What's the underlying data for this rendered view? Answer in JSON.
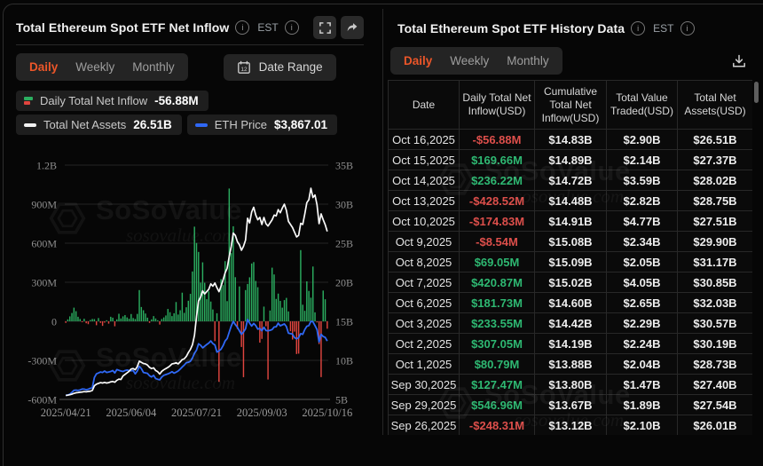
{
  "colors": {
    "accent_orange": "#eb5629",
    "green": "#2eb872",
    "red": "#dd4f4b",
    "bar_green": "#2bae60",
    "bar_red": "#e0453f",
    "line_white": "#fafafa",
    "line_blue": "#2f68f5"
  },
  "brand": {
    "watermark_title": "SoSoValue",
    "watermark_domain": "sosovalue.com"
  },
  "left_panel": {
    "title": "Total Ethereum Spot ETF Net Inflow",
    "timezone_label": "EST",
    "tabs": [
      {
        "label": "Daily",
        "active": true
      },
      {
        "label": "Weekly",
        "active": false
      },
      {
        "label": "Monthly",
        "active": false
      }
    ],
    "date_range_button": {
      "label": "Date Range",
      "calendar_day": "12"
    },
    "legend": {
      "inflow": {
        "label": "Daily Total Net Inflow",
        "value": "-56.88M"
      },
      "assets": {
        "label": "Total Net Assets",
        "value": "26.51B"
      },
      "eth_price": {
        "label": "ETH Price",
        "value": "$3,867.01"
      }
    }
  },
  "right_panel": {
    "title": "Total Ethereum Spot ETF History Data",
    "timezone_label": "EST",
    "tabs": [
      {
        "label": "Daily",
        "active": true
      },
      {
        "label": "Weekly",
        "active": false
      },
      {
        "label": "Monthly",
        "active": false
      }
    ],
    "table": {
      "columns": [
        "Date",
        "Daily Total Net Inflow(USD)",
        "Cumulative Total Net Inflow(USD)",
        "Total Value Traded(USD)",
        "Total Net Assets(USD)"
      ],
      "rows": [
        {
          "date": "Oct 16,2025",
          "daily_inflow": "-$56.88M",
          "cumulative_inflow": "$14.83B",
          "value_traded": "$2.90B",
          "net_assets": "$26.51B"
        },
        {
          "date": "Oct 15,2025",
          "daily_inflow": "$169.66M",
          "cumulative_inflow": "$14.89B",
          "value_traded": "$2.14B",
          "net_assets": "$27.37B"
        },
        {
          "date": "Oct 14,2025",
          "daily_inflow": "$236.22M",
          "cumulative_inflow": "$14.72B",
          "value_traded": "$3.59B",
          "net_assets": "$28.02B"
        },
        {
          "date": "Oct 13,2025",
          "daily_inflow": "-$428.52M",
          "cumulative_inflow": "$14.48B",
          "value_traded": "$2.82B",
          "net_assets": "$28.75B"
        },
        {
          "date": "Oct 10,2025",
          "daily_inflow": "-$174.83M",
          "cumulative_inflow": "$14.91B",
          "value_traded": "$4.77B",
          "net_assets": "$27.51B"
        },
        {
          "date": "Oct 9,2025",
          "daily_inflow": "-$8.54M",
          "cumulative_inflow": "$15.08B",
          "value_traded": "$2.34B",
          "net_assets": "$29.90B"
        },
        {
          "date": "Oct 8,2025",
          "daily_inflow": "$69.05M",
          "cumulative_inflow": "$15.09B",
          "value_traded": "$2.05B",
          "net_assets": "$31.17B"
        },
        {
          "date": "Oct 7,2025",
          "daily_inflow": "$420.87M",
          "cumulative_inflow": "$15.02B",
          "value_traded": "$4.05B",
          "net_assets": "$30.85B"
        },
        {
          "date": "Oct 6,2025",
          "daily_inflow": "$181.73M",
          "cumulative_inflow": "$14.60B",
          "value_traded": "$2.65B",
          "net_assets": "$32.03B"
        },
        {
          "date": "Oct 3,2025",
          "daily_inflow": "$233.55M",
          "cumulative_inflow": "$14.42B",
          "value_traded": "$2.29B",
          "net_assets": "$30.57B"
        },
        {
          "date": "Oct 2,2025",
          "daily_inflow": "$307.05M",
          "cumulative_inflow": "$14.19B",
          "value_traded": "$2.24B",
          "net_assets": "$30.19B"
        },
        {
          "date": "Oct 1,2025",
          "daily_inflow": "$80.79M",
          "cumulative_inflow": "$13.88B",
          "value_traded": "$2.04B",
          "net_assets": "$28.73B"
        },
        {
          "date": "Sep 30,2025",
          "daily_inflow": "$127.47M",
          "cumulative_inflow": "$13.80B",
          "value_traded": "$1.47B",
          "net_assets": "$27.40B"
        },
        {
          "date": "Sep 29,2025",
          "daily_inflow": "$546.96M",
          "cumulative_inflow": "$13.67B",
          "value_traded": "$1.89B",
          "net_assets": "$27.54B"
        },
        {
          "date": "Sep 26,2025",
          "daily_inflow": "-$248.31M",
          "cumulative_inflow": "$13.12B",
          "value_traded": "$2.10B",
          "net_assets": "$26.01B"
        }
      ]
    }
  },
  "chart_data": {
    "type": "composite",
    "x_tick_labels": [
      "2025/04/21",
      "2025/06/04",
      "2025/07/21",
      "2025/09/03",
      "2025/10/16"
    ],
    "left_axis": {
      "title": "Daily Net Inflow (USD)",
      "ticks": [
        "1.2B",
        "900M",
        "600M",
        "300M",
        "0",
        "-300M",
        "-600M"
      ],
      "max_m": 1200,
      "min_m": -600
    },
    "right_axis": {
      "title": "Total Net Assets (USD)",
      "ticks": [
        "35B",
        "30B",
        "25B",
        "20B",
        "15B",
        "10B",
        "5B"
      ],
      "max_b": 35,
      "min_b": 5
    },
    "eth_axis": {
      "hidden": true,
      "min_usd": 1400,
      "max_usd": 5000
    },
    "grid": true,
    "legend_position": "top-left",
    "series": [
      {
        "name": "Daily Total Net Inflow",
        "type": "bar",
        "unit": "M USD",
        "values": [
          -12,
          15,
          38,
          64,
          105,
          78,
          35,
          18,
          -6,
          20,
          -15,
          -22,
          10,
          18,
          17,
          -30,
          25,
          -12,
          -35,
          -10,
          8,
          -18,
          35,
          28,
          -38,
          15,
          58,
          22,
          38,
          48,
          30,
          20,
          56,
          25,
          18,
          57,
          240,
          110,
          85,
          60,
          28,
          -12,
          15,
          40,
          22,
          8,
          -25,
          18,
          30,
          45,
          95,
          70,
          40,
          62,
          148,
          52,
          85,
          220,
          65,
          108,
          158,
          211,
          383,
          727,
          602,
          533,
          297,
          453,
          296,
          170,
          230,
          152,
          91,
          -152,
          62,
          -465,
          324,
          278,
          462,
          155,
          1020,
          524,
          730,
          339,
          -59,
          268,
          -197,
          -429,
          240,
          287,
          338,
          444,
          455,
          310,
          262,
          -164,
          -135,
          113,
          -38,
          -447,
          83,
          412,
          360,
          172,
          213,
          157,
          105,
          163,
          180,
          76,
          -76,
          -140,
          -79,
          -251,
          -248.31,
          546.96,
          127.47,
          80.79,
          307.05,
          233.55,
          181.73,
          420.87,
          69.05,
          -8.54,
          -174.83,
          -428.52,
          236.22,
          169.66,
          -56.88
        ]
      },
      {
        "name": "Total Net Assets",
        "type": "line",
        "unit": "B USD",
        "values": [
          5.5,
          5.55,
          5.6,
          5.68,
          5.78,
          5.85,
          5.88,
          5.92,
          5.95,
          6.0,
          5.98,
          6.02,
          6.05,
          6.15,
          6.75,
          6.95,
          7.05,
          7.15,
          7.1,
          7.18,
          7.1,
          7.15,
          7.25,
          7.3,
          7.2,
          7.45,
          7.6,
          7.55,
          8.0,
          8.2,
          8.4,
          8.6,
          8.9,
          8.95,
          8.8,
          9.2,
          9.9,
          9.75,
          9.6,
          9.55,
          9.4,
          9.1,
          8.95,
          9.05,
          8.7,
          8.55,
          8.25,
          8.6,
          8.8,
          8.95,
          9.1,
          9.3,
          9.55,
          9.6,
          9.7,
          9.55,
          9.8,
          10.1,
          10.2,
          10.5,
          11.0,
          11.4,
          12.0,
          13.2,
          15.6,
          17.6,
          18.1,
          18.9,
          18.5,
          18.8,
          19.1,
          19.8,
          19.5,
          19.9,
          19.3,
          18.8,
          19.5,
          20.3,
          21.2,
          21.8,
          23.3,
          24.6,
          26.3,
          26.0,
          25.2,
          24.8,
          24.1,
          24.6,
          25.4,
          28.2,
          27.6,
          29.0,
          29.6,
          28.6,
          28.0,
          28.3,
          27.4,
          28.3,
          27.5,
          27.2,
          27.6,
          28.0,
          28.6,
          28.5,
          29.3,
          28.9,
          29.5,
          30.0,
          29.2,
          27.8,
          27.4,
          27.0,
          26.4,
          25.8,
          26.01,
          27.54,
          27.4,
          28.73,
          30.19,
          30.57,
          32.03,
          30.85,
          31.17,
          29.9,
          27.51,
          28.75,
          28.02,
          27.37,
          26.51
        ]
      },
      {
        "name": "ETH Price",
        "type": "line",
        "unit": "USD",
        "values": [
          1577,
          1585,
          1620,
          1700,
          1786,
          1795,
          1780,
          1800,
          1840,
          1835,
          1810,
          1830,
          1870,
          1900,
          2325,
          2480,
          2520,
          2560,
          2540,
          2600,
          2540,
          2560,
          2580,
          2620,
          2520,
          2660,
          2630,
          2600,
          2580,
          2620,
          2640,
          2620,
          2610,
          2620,
          2480,
          2600,
          2800,
          2700,
          2540,
          2520,
          2500,
          2400,
          2350,
          2420,
          2280,
          2250,
          2230,
          2350,
          2420,
          2450,
          2480,
          2520,
          2570,
          2510,
          2550,
          2600,
          2680,
          2770,
          2850,
          2950,
          2970,
          3010,
          3150,
          3350,
          3480,
          3750,
          3690,
          3580,
          3650,
          3720,
          3780,
          3870,
          3760,
          3700,
          3400,
          3450,
          3520,
          3670,
          3870,
          3970,
          4240,
          4500,
          4700,
          4560,
          4450,
          4300,
          4150,
          4250,
          4380,
          4780,
          4620,
          4500,
          4610,
          4520,
          4370,
          4400,
          4300,
          4450,
          4310,
          4300,
          4320,
          4350,
          4460,
          4470,
          4620,
          4510,
          4550,
          4590,
          4480,
          4200,
          4180,
          4160,
          4010,
          3960,
          4010,
          4180,
          4150,
          4350,
          4490,
          4520,
          4700,
          4680,
          4520,
          4350,
          3830,
          4150,
          4060,
          4020,
          3867
        ]
      }
    ]
  }
}
